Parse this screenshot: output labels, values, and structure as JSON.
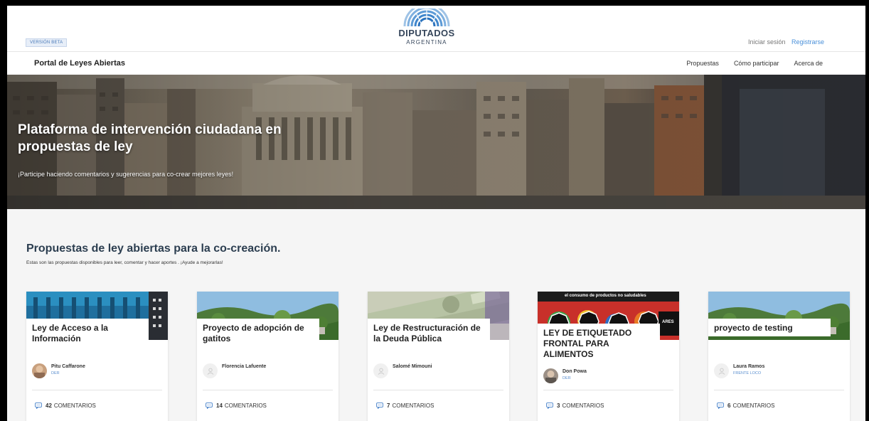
{
  "header": {
    "beta_badge": "VERSIÓN BETA",
    "logo_title": "DIPUTADOS",
    "logo_subtitle": "ARGENTINA",
    "login": "Iniciar sesión",
    "signup": "Registrarse"
  },
  "nav": {
    "brand": "Portal de Leyes Abiertas",
    "links": [
      "Propuestas",
      "Cómo participar",
      "Acerca de"
    ]
  },
  "hero": {
    "title": "Plataforma de intervención ciudadana en propuestas de ley",
    "subtitle": "¡Participe haciendo comentarios y sugerencias para co-crear mejores leyes!"
  },
  "section": {
    "title": "Propuestas de ley abiertas para la co-creación.",
    "subtitle": "Estas son las propuestas disponibles para leer, comentar y hacer aportes . ¡Ayude a mejorarlas!"
  },
  "cards": [
    {
      "title": "Ley de Acceso a la Información",
      "author": "Pitu Caffarone",
      "party": "DER",
      "comments_count": "42",
      "comments_label": "COMENTARIOS",
      "image": "building-columns"
    },
    {
      "title": "Proyecto de adopción de gatitos",
      "author": "Florencia Lafuente",
      "party": "",
      "comments_count": "14",
      "comments_label": "COMENTARIOS",
      "image": "landscape"
    },
    {
      "title": "Ley de Restructuración de la Deuda Pública",
      "author": "Salomé Mimouni",
      "party": "",
      "comments_count": "7",
      "comments_label": "COMENTARIOS",
      "image": "dollar-bills"
    },
    {
      "title": "LEY DE ETIQUETADO FRONTAL PARA ALIMENTOS",
      "author": "Don Powa",
      "party": "DER",
      "comments_count": "3",
      "comments_label": "COMENTARIOS",
      "image": "food-warning-labels",
      "image_caption": "el consumo de productos no saludables",
      "image_label_fragment": "ARES"
    },
    {
      "title": "proyecto de testing",
      "author": "Laura Ramos",
      "party": "FRENTE LOCO",
      "comments_count": "6",
      "comments_label": "COMENTARIOS",
      "image": "landscape"
    }
  ],
  "colors": {
    "accent": "#4a90d9",
    "heading": "#2c3e50",
    "party": "#5b8fcf"
  }
}
